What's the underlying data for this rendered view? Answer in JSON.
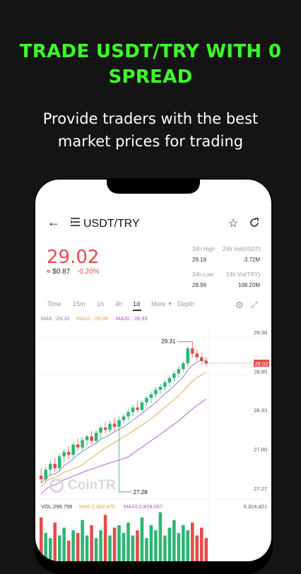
{
  "promo": {
    "headline_line1": "TRADE USDT/TRY WITH 0",
    "headline_line2": "SPREAD",
    "subline_line1": "Provide traders with the best",
    "subline_line2": "market prices for trading"
  },
  "app": {
    "pair": "USDT/TRY",
    "price": "29.02",
    "fiat_price": "≈ $0.87",
    "change": "-0.20%",
    "stats": {
      "high_label": "24h High",
      "high_value": "29.18",
      "vol_usdt_label": "24h Vol(USDT)",
      "vol_usdt_value": "3.72M",
      "low_label": "24h Low",
      "low_value": "28.99",
      "vol_try_label": "24h Vol(TRY)",
      "vol_try_value": "108.20M"
    },
    "tabs": [
      "Time",
      "15m",
      "1h",
      "4h",
      "1d",
      "More",
      "Depth"
    ],
    "active_tab": "1d",
    "ma_labels": {
      "ma5": "MA5 : 29.10",
      "ma10": "MA10 : 29.08",
      "ma20": "MA20 : 28.93"
    },
    "vol_labels": {
      "vol": "VOL:299,758",
      "ma5": "MA5:2,382,470",
      "ma10": "MA10:2,919,057",
      "max": "5,324,421"
    },
    "watermark": "CoinTR",
    "colors": {
      "up": "#2bb673",
      "down": "#e64a4a",
      "accent": "#3cff2a"
    }
  },
  "chart_data": {
    "type": "candlestick",
    "y_ticks": [
      "29.38",
      "28.85",
      "28.33",
      "27.80",
      "27.27"
    ],
    "current_price_label": "29.02",
    "high_marker": "29.31",
    "low_marker": "27.28",
    "candles": [
      [
        27.5,
        27.6,
        27.4,
        27.45
      ],
      [
        27.45,
        27.62,
        27.4,
        27.58
      ],
      [
        27.58,
        27.7,
        27.5,
        27.66
      ],
      [
        27.66,
        27.74,
        27.55,
        27.6
      ],
      [
        27.6,
        27.8,
        27.57,
        27.76
      ],
      [
        27.76,
        27.86,
        27.68,
        27.82
      ],
      [
        27.82,
        27.9,
        27.72,
        27.78
      ],
      [
        27.78,
        27.95,
        27.74,
        27.92
      ],
      [
        27.92,
        28.0,
        27.84,
        27.88
      ],
      [
        27.88,
        28.02,
        27.84,
        27.98
      ],
      [
        27.98,
        28.06,
        27.9,
        28.03
      ],
      [
        28.03,
        28.1,
        27.93,
        27.97
      ],
      [
        27.97,
        28.12,
        27.94,
        28.08
      ],
      [
        28.08,
        28.18,
        28.0,
        28.15
      ],
      [
        28.15,
        28.22,
        28.07,
        28.12
      ],
      [
        28.12,
        28.24,
        28.08,
        28.2
      ],
      [
        28.2,
        28.28,
        28.1,
        28.16
      ],
      [
        28.16,
        28.3,
        27.28,
        28.25
      ],
      [
        28.25,
        28.34,
        28.2,
        28.3
      ],
      [
        28.3,
        28.4,
        28.24,
        28.36
      ],
      [
        28.36,
        28.46,
        28.3,
        28.42
      ],
      [
        28.42,
        28.5,
        28.35,
        28.39
      ],
      [
        28.39,
        28.52,
        28.36,
        28.49
      ],
      [
        28.49,
        28.58,
        28.44,
        28.55
      ],
      [
        28.55,
        28.64,
        28.48,
        28.6
      ],
      [
        28.6,
        28.7,
        28.55,
        28.66
      ],
      [
        28.66,
        28.74,
        28.6,
        28.7
      ],
      [
        28.7,
        28.8,
        28.64,
        28.76
      ],
      [
        28.76,
        28.86,
        28.7,
        28.82
      ],
      [
        28.82,
        28.92,
        28.76,
        28.88
      ],
      [
        28.88,
        28.98,
        28.82,
        28.94
      ],
      [
        28.94,
        29.05,
        28.9,
        29.02
      ],
      [
        29.02,
        29.25,
        28.98,
        29.22
      ],
      [
        29.22,
        29.31,
        29.1,
        29.15
      ],
      [
        29.15,
        29.2,
        29.05,
        29.1
      ],
      [
        29.1,
        29.16,
        29.0,
        29.05
      ],
      [
        29.05,
        29.1,
        28.98,
        29.02
      ]
    ],
    "volumes": [
      0.85,
      0.55,
      0.45,
      0.75,
      0.5,
      0.65,
      0.4,
      0.6,
      0.55,
      0.8,
      0.5,
      0.7,
      0.45,
      0.6,
      0.9,
      0.5,
      0.65,
      0.7,
      0.55,
      0.75,
      0.5,
      0.6,
      0.85,
      0.45,
      0.7,
      0.6,
      0.95,
      0.5,
      0.65,
      0.8,
      0.55,
      0.7,
      0.6,
      0.75,
      0.5,
      0.65,
      0.45
    ]
  }
}
